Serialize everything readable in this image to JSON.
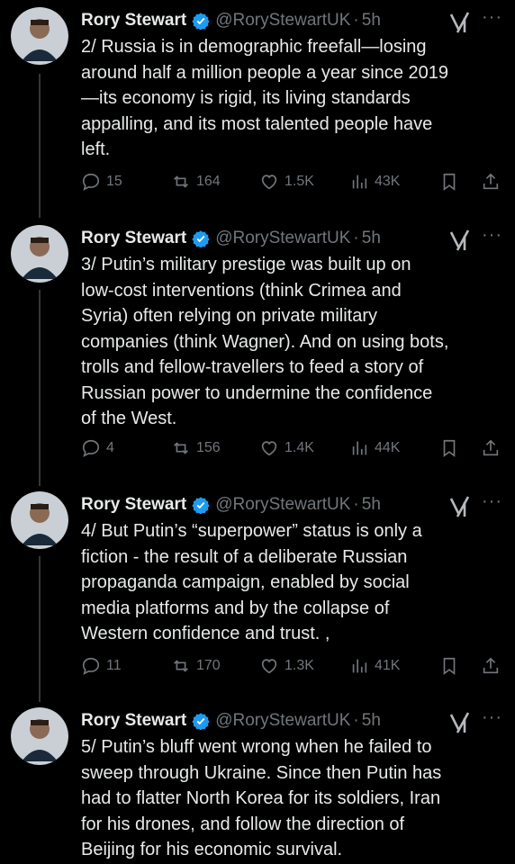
{
  "tweets": [
    {
      "author": "Rory Stewart",
      "handle": "@RoryStewartUK",
      "time": "5h",
      "text": "2/ Russia is in demographic freefall—losing\naround half a million people a year since 2019\n—its economy is rigid, its living standards\nappalling, and its most talented people have\nleft.",
      "replies": "15",
      "reposts": "164",
      "likes": "1.5K",
      "views": "43K"
    },
    {
      "author": "Rory Stewart",
      "handle": "@RoryStewartUK",
      "time": "5h",
      "text": "3/ Putin’s military prestige was built up on\nlow-cost interventions (think Crimea and\nSyria) often relying on private military\ncompanies (think Wagner). And on using bots,\ntrolls and fellow-travellers to feed a story of\nRussian power to undermine the confidence\nof the West.",
      "replies": "4",
      "reposts": "156",
      "likes": "1.4K",
      "views": "44K"
    },
    {
      "author": "Rory Stewart",
      "handle": "@RoryStewartUK",
      "time": "5h",
      "text": "4/ But Putin’s “superpower” status is only a\nfiction - the result of a deliberate Russian\npropaganda campaign, enabled by social\nmedia platforms and by the collapse of\nWestern confidence and trust. ,",
      "replies": "11",
      "reposts": "170",
      "likes": "1.3K",
      "views": "41K"
    },
    {
      "author": "Rory Stewart",
      "handle": "@RoryStewartUK",
      "time": "5h",
      "text": "5/ Putin’s bluff went wrong when he failed to\nsweep through Ukraine.  Since then Putin has\nhad to flatter North Korea for its soldiers, Iran\nfor his drones, and follow the direction of\nBeijing for his economic survival."
    }
  ],
  "separator_dot": "·",
  "colors": {
    "background": "#000000",
    "text": "#e7e9ea",
    "muted": "#71767b",
    "verified": "#1d9bf0"
  }
}
